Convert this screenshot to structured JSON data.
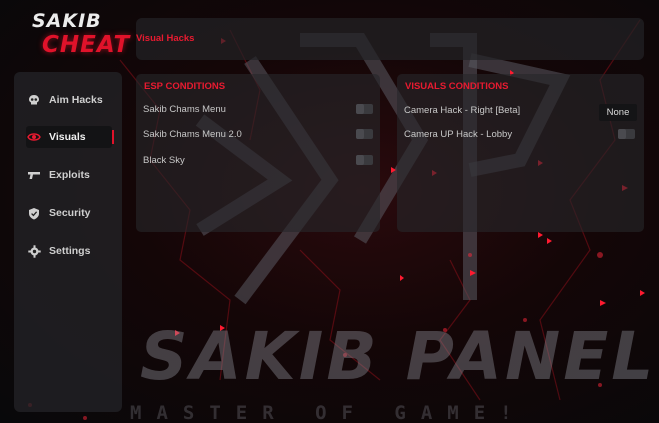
{
  "brand": {
    "line1": "SAKIB",
    "line2": "CHEAT"
  },
  "watermark": {
    "title": "SAKIB PANEL",
    "subtitle": "MASTER OF GAME!"
  },
  "colors": {
    "accent": "#e0122a",
    "panel": "#26262a",
    "background": "#0a0a0c"
  },
  "sidebar": {
    "items": [
      {
        "label": "Aim Hacks",
        "icon": "skull-icon",
        "active": false
      },
      {
        "label": "Visuals",
        "icon": "eye-icon",
        "active": true
      },
      {
        "label": "Exploits",
        "icon": "gun-icon",
        "active": false
      },
      {
        "label": "Security",
        "icon": "shield-icon",
        "active": false
      },
      {
        "label": "Settings",
        "icon": "gear-icon",
        "active": false
      }
    ]
  },
  "header": {
    "title": "Visual Hacks"
  },
  "esp": {
    "title": "ESP CONDITIONS",
    "rows": [
      {
        "label": "Sakib Chams Menu",
        "enabled": false
      },
      {
        "label": "Sakib Chams Menu 2.0",
        "enabled": false
      },
      {
        "label": "Black Sky",
        "enabled": false
      }
    ]
  },
  "visuals": {
    "title": "VISUALS CONDITIONS",
    "rows": [
      {
        "label": "Camera Hack - Right [Beta]",
        "control": "dropdown",
        "value": "None"
      },
      {
        "label": "Camera UP Hack - Lobby",
        "control": "toggle",
        "enabled": false
      }
    ]
  }
}
